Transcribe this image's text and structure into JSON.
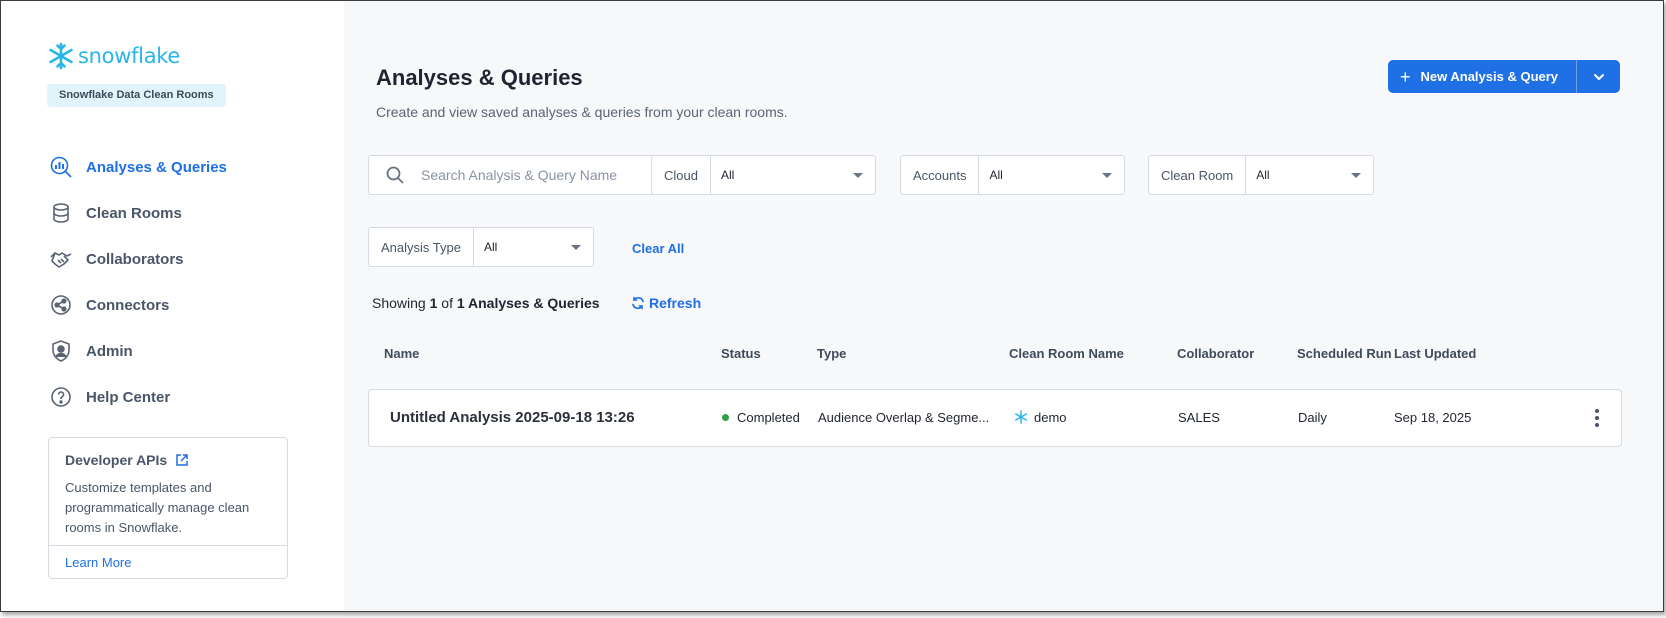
{
  "brand": {
    "logo_text": "snowflake",
    "product_name": "Snowflake Data Clean Rooms",
    "accent_color": "#29b5e8"
  },
  "sidebar": {
    "items": [
      {
        "label": "Analyses & Queries",
        "icon": "analyses-icon",
        "active": true
      },
      {
        "label": "Clean Rooms",
        "icon": "database-icon",
        "active": false
      },
      {
        "label": "Collaborators",
        "icon": "handshake-icon",
        "active": false
      },
      {
        "label": "Connectors",
        "icon": "connectors-icon",
        "active": false
      },
      {
        "label": "Admin",
        "icon": "admin-shield-icon",
        "active": false
      },
      {
        "label": "Help Center",
        "icon": "help-icon",
        "active": false
      }
    ],
    "dev_card": {
      "title": "Developer APIs",
      "body": "Customize templates and programmatically manage clean rooms in Snowflake.",
      "link": "Learn More"
    }
  },
  "header": {
    "title": "Analyses & Queries",
    "subtitle": "Create and view saved analyses & queries from your clean rooms.",
    "new_button_label": "New Analysis & Query"
  },
  "filters": {
    "search_placeholder": "Search Analysis & Query Name",
    "cloud": {
      "label": "Cloud",
      "value": "All"
    },
    "accounts": {
      "label": "Accounts",
      "value": "All"
    },
    "clean_room": {
      "label": "Clean Room",
      "value": "All"
    },
    "analysis_type": {
      "label": "Analysis Type",
      "value": "All"
    },
    "clear_all": "Clear All"
  },
  "results": {
    "showing_prefix": "Showing",
    "shown_count": "1",
    "of": "of",
    "total_label": "1 Analyses & Queries",
    "refresh_label": "Refresh"
  },
  "table": {
    "columns": {
      "name": "Name",
      "status": "Status",
      "type": "Type",
      "clean_room": "Clean Room Name",
      "collaborator": "Collaborator",
      "scheduled": "Scheduled Run",
      "updated": "Last Updated"
    },
    "rows": [
      {
        "name": "Untitled Analysis 2025-09-18 13:26",
        "status": "Completed",
        "status_color": "#2ea043",
        "type": "Audience Overlap & Segme...",
        "clean_room": "demo",
        "collaborator": "SALES",
        "scheduled": "Daily",
        "updated": "Sep 18, 2025"
      }
    ]
  }
}
